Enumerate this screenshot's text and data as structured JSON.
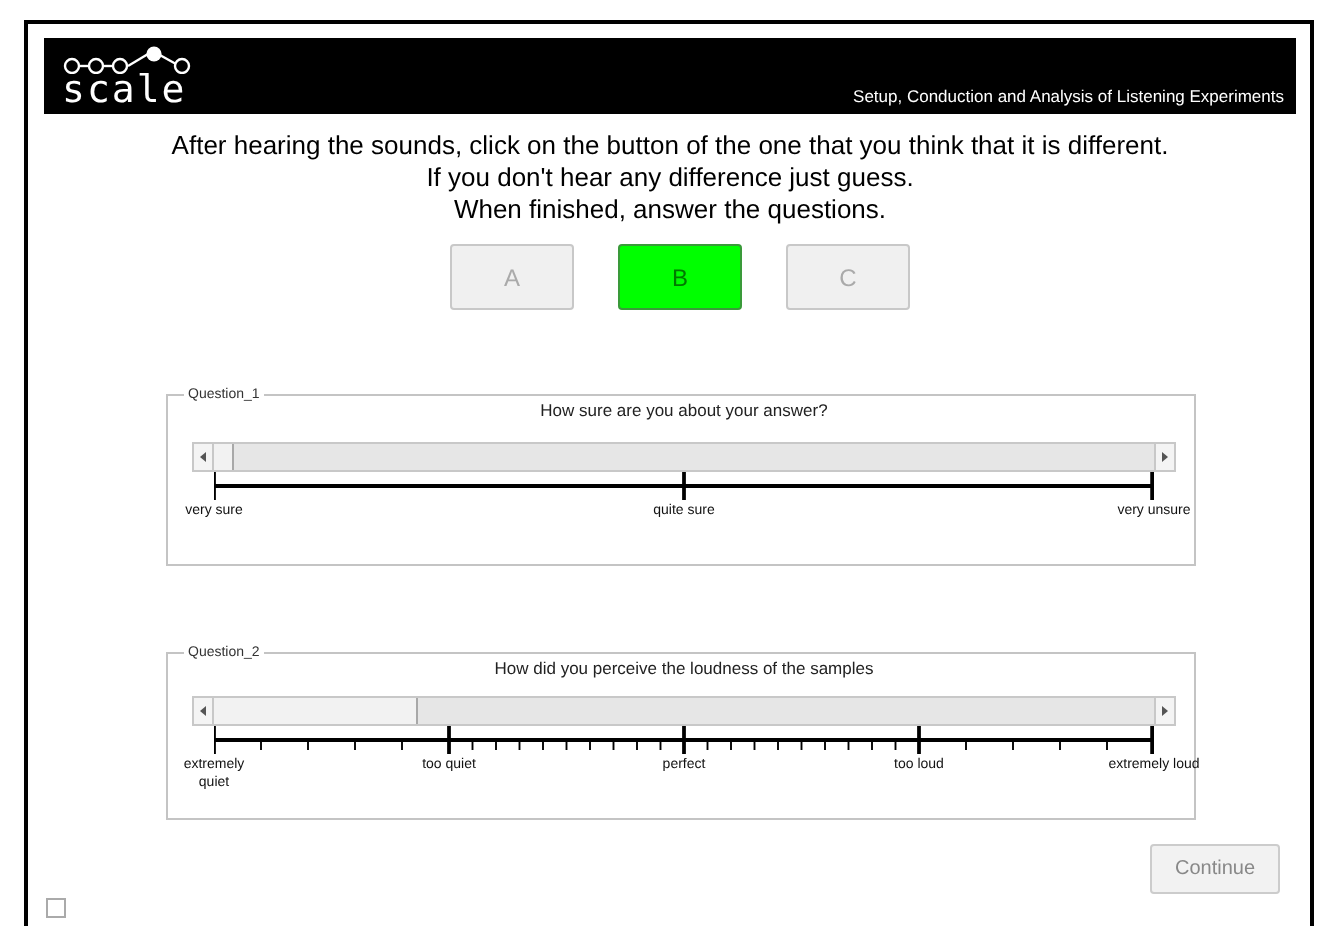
{
  "header": {
    "logo": "scale",
    "subtitle": "Setup, Conduction and Analysis of Listening Experiments"
  },
  "instructions": [
    "After hearing the sounds, click on the button of the one that you think that it is different.",
    "If you don't hear any difference just guess.",
    "When finished, answer the questions."
  ],
  "choices": [
    {
      "label": "A",
      "selected": false
    },
    {
      "label": "B",
      "selected": true
    },
    {
      "label": "C",
      "selected": false
    }
  ],
  "questions": [
    {
      "legend": "Question_1",
      "prompt": "How sure are you about your answer?",
      "level": 0,
      "scale_labels": [
        "very sure",
        "quite sure",
        "very unsure"
      ]
    },
    {
      "legend": "Question_2",
      "prompt": "How did you perceive the loudness of the samples",
      "level": 0.2,
      "scale_labels": [
        "extremely\nquiet",
        "too quiet",
        "perfect",
        "too loud",
        "extremely loud"
      ]
    }
  ],
  "footer": {
    "checkbox": {
      "checked": false
    },
    "continue_button": {
      "label": "Continue",
      "disabled": true
    }
  }
}
